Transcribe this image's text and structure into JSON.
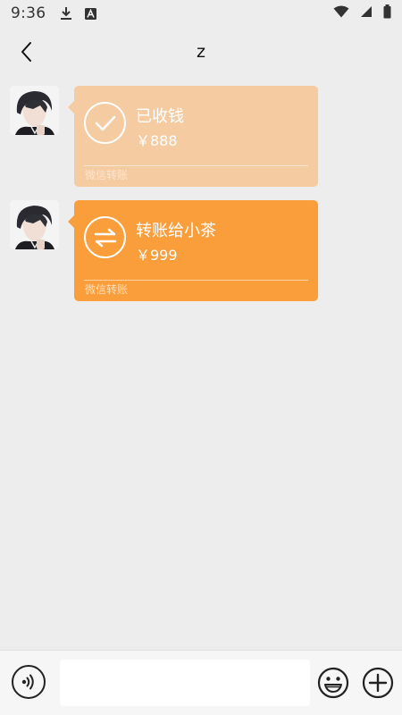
{
  "status_bar": {
    "time": "9:36",
    "icons": [
      "download-icon",
      "app-notification-icon",
      "wifi-icon",
      "signal-icon",
      "battery-icon"
    ]
  },
  "header": {
    "title": "z",
    "back_icon": "chevron-left-icon"
  },
  "messages": [
    {
      "type": "transfer-received",
      "icon": "check-icon",
      "title": "已收钱",
      "amount": "￥888",
      "footer": "微信转账",
      "color": "#f5cba1"
    },
    {
      "type": "transfer-pending",
      "icon": "transfer-arrows-icon",
      "title": "转账给小茶",
      "amount": "￥999",
      "footer": "微信转账",
      "color": "#fa9e3b"
    }
  ],
  "input_bar": {
    "input_value": "",
    "voice_icon": "voice-icon",
    "emoji_icon": "emoji-icon",
    "plus_icon": "plus-icon"
  }
}
